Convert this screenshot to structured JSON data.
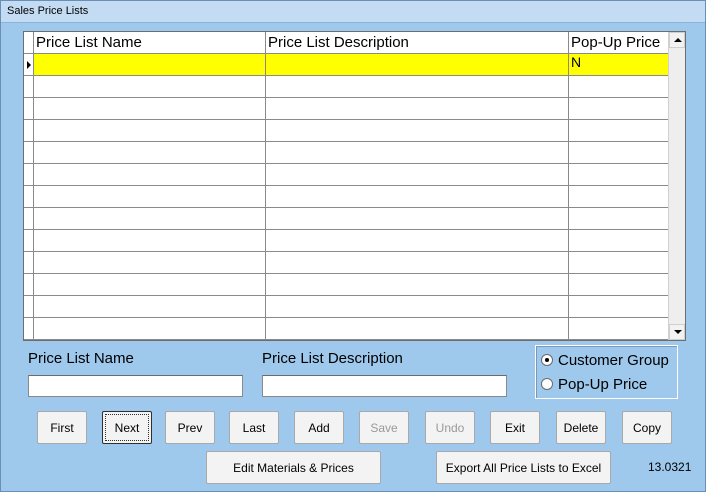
{
  "window": {
    "title": "Sales Price Lists"
  },
  "grid": {
    "columns": [
      "Price List Name",
      "Price List Description",
      "Pop-Up Price"
    ],
    "rows": [
      {
        "name": "",
        "description": "",
        "popup": "N",
        "current": true
      },
      {
        "name": "",
        "description": "",
        "popup": ""
      },
      {
        "name": "",
        "description": "",
        "popup": ""
      },
      {
        "name": "",
        "description": "",
        "popup": ""
      },
      {
        "name": "",
        "description": "",
        "popup": ""
      },
      {
        "name": "",
        "description": "",
        "popup": ""
      },
      {
        "name": "",
        "description": "",
        "popup": ""
      },
      {
        "name": "",
        "description": "",
        "popup": ""
      },
      {
        "name": "",
        "description": "",
        "popup": ""
      },
      {
        "name": "",
        "description": "",
        "popup": ""
      },
      {
        "name": "",
        "description": "",
        "popup": ""
      },
      {
        "name": "",
        "description": "",
        "popup": ""
      },
      {
        "name": "",
        "description": "",
        "popup": ""
      }
    ],
    "highlight_color": "#ffff00",
    "scroll_up_icon": "arrow-up-icon",
    "scroll_down_icon": "arrow-down-icon"
  },
  "form": {
    "name_label": "Price List Name",
    "name_value": "",
    "description_label": "Price List Description",
    "description_value": ""
  },
  "options": {
    "customer_group_label": "Customer Group",
    "popup_price_label": "Pop-Up Price",
    "selected": "Customer Group"
  },
  "buttons": {
    "first": "First",
    "next": "Next",
    "prev": "Prev",
    "last": "Last",
    "add": "Add",
    "save": "Save",
    "undo": "Undo",
    "exit": "Exit",
    "delete": "Delete",
    "copy": "Copy",
    "edit_materials": "Edit Materials & Prices",
    "export_all": "Export All Price Lists to Excel"
  },
  "version": "13.0321",
  "colors": {
    "window_background": "#9ec8ec",
    "title_bar": "#c4dcf3"
  }
}
